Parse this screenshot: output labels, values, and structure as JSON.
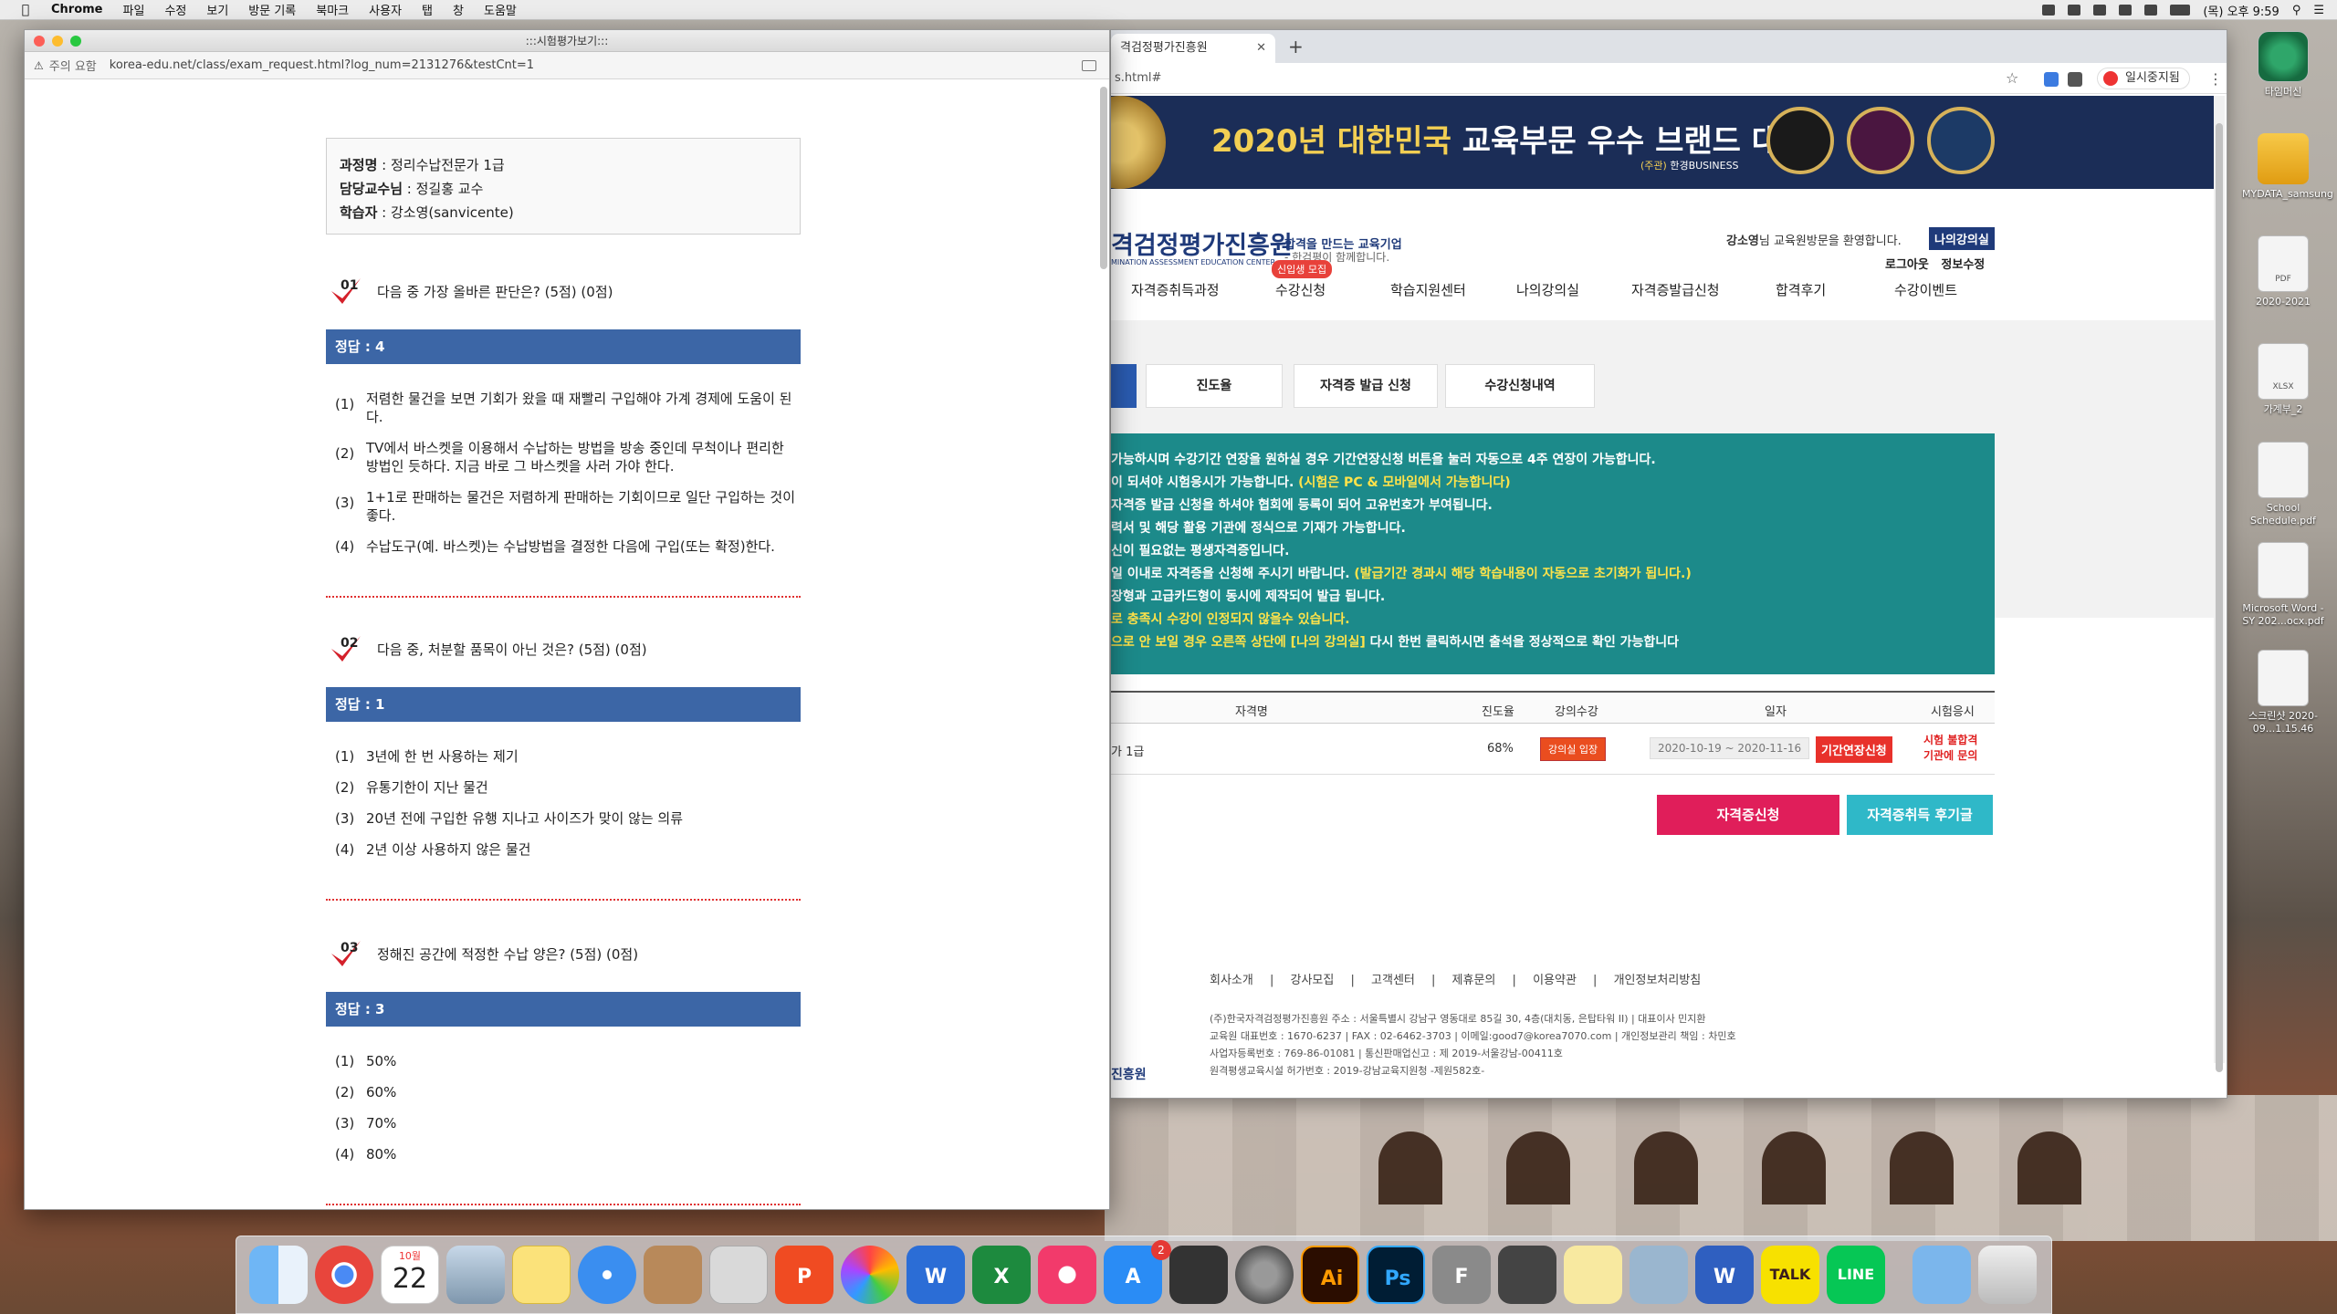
{
  "menubar": {
    "app": "Chrome",
    "items": [
      "파일",
      "수정",
      "보기",
      "방문 기록",
      "북마크",
      "사용자",
      "탭",
      "창",
      "도움말"
    ],
    "clock": "(목) 오후 9:59"
  },
  "popup": {
    "title": ":::시험평가보기:::",
    "security": "주의 요함",
    "url": "korea-edu.net/class/exam_request.html?log_num=2131276&testCnt=1",
    "info": {
      "course_label": "과정명",
      "course": "정리수납전문가 1급",
      "prof_label": "담당교수님",
      "prof": "정길홍 교수",
      "student_label": "학습자",
      "student": "강소영(sanvicente)"
    },
    "questions": [
      {
        "num": "01",
        "text": "다음 중 가장 올바른 판단은? (5점) (0점)",
        "answer": "정답 : 4",
        "options": [
          {
            "n": "(1)",
            "t": "저렴한 물건을 보면 기회가 왔을 때 재빨리 구입해야 가계 경제에 도움이 된다."
          },
          {
            "n": "(2)",
            "t": "TV에서 바스켓을 이용해서 수납하는 방법을 방송 중인데 무척이나 편리한 방법인 듯하다. 지금 바로 그 바스켓을 사러 가야 한다."
          },
          {
            "n": "(3)",
            "t": "1+1로 판매하는 물건은 저렴하게 판매하는 기회이므로 일단 구입하는 것이 좋다."
          },
          {
            "n": "(4)",
            "t": "수납도구(예. 바스켓)는 수납방법을 결정한 다음에 구입(또는 확정)한다."
          }
        ]
      },
      {
        "num": "02",
        "text": "다음 중, 처분할 품목이 아닌 것은? (5점) (0점)",
        "answer": "정답 : 1",
        "options": [
          {
            "n": "(1)",
            "t": "3년에 한 번 사용하는 제기"
          },
          {
            "n": "(2)",
            "t": "유통기한이 지난 물건"
          },
          {
            "n": "(3)",
            "t": "20년 전에 구입한 유행 지나고 사이즈가 맞이 않는 의류"
          },
          {
            "n": "(4)",
            "t": "2년 이상 사용하지 않은 물건"
          }
        ]
      },
      {
        "num": "03",
        "text": "정해진 공간에 적정한 수납 양은? (5점) (0점)",
        "answer": "정답 : 3",
        "options": [
          {
            "n": "(1)",
            "t": "50%"
          },
          {
            "n": "(2)",
            "t": "60%"
          },
          {
            "n": "(3)",
            "t": "70%"
          },
          {
            "n": "(4)",
            "t": "80%"
          }
        ]
      }
    ]
  },
  "chrome": {
    "tab_title": "격검정평가진흥원",
    "url_fragment": "s.html#",
    "pause_label": "일시중지됨",
    "banner_title_a": "2020년 ",
    "banner_title_b": "대한민국",
    "banner_title_c": " 교육부문 우수 브랜드 대상",
    "banner_sub_a": "(주관) ",
    "banner_sub_b": "한경BUSINESS",
    "logo": "격검정평가진흥원",
    "logo_en": "MINATION ASSESSMENT  EDUCATION CENTER",
    "slogan": "합격을 만드는 교육기업",
    "slogan2": "- 한검평이 함께합니다.",
    "welcome_name": "강소영",
    "welcome_rest": "님 교육원방문을 환영합니다.",
    "my_lecture": "나의강의실",
    "logout": "로그아웃",
    "edit_info": "정보수정",
    "nav": [
      "자격증취득과정",
      "수강신청",
      "학습지원센터",
      "나의강의실",
      "자격증발급신청",
      "합격후기",
      "수강이벤트"
    ],
    "new_tag": "신입생 모집",
    "subtabs": [
      "진도율",
      "자격증 발급 신청",
      "수강신청내역"
    ],
    "notice": [
      {
        "a": "가능하시며 수강기간 연장을 원하실 경우 기간연장신청 버튼을 눌러 자동으로 4주 연장이 가능합니다.",
        "b": ""
      },
      {
        "a": "이 되셔야 시험응시가 가능합니다. ",
        "b": "(시험은 PC & 모바일에서 가능합니다)"
      },
      {
        "a": "자격증 발급 신청을 하셔야 협회에 등록이 되어 고유번호가 부여됩니다.",
        "b": ""
      },
      {
        "a": "력서 및 해당 활용 기관에 정식으로 기재가 가능합니다.",
        "b": ""
      },
      {
        "a": "신이 필요없는 평생자격증입니다.",
        "b": ""
      },
      {
        "a": "일 이내로 자격증을 신청해 주시기 바랍니다. ",
        "b": "(발급기간 경과시 해당 학습내용이 자동으로 초기화가 됩니다.)"
      },
      {
        "a": "장형과 고급카드형이 동시에 제작되어 발급 됩니다.",
        "b": ""
      },
      {
        "a": "",
        "b": "로 충족시 수강이 인정되지 않을수 있습니다."
      },
      {
        "a": "",
        "b": "으로 안 보일 경우 오른쪽 상단에 [나의 강의실]",
        "c": " 다시 한번 클릭하시면 출석을 정상적으로 확인 가능합니다"
      }
    ],
    "table": {
      "headers": [
        "자격명",
        "진도율",
        "강의수강",
        "일자",
        "시험응시"
      ],
      "row": {
        "name": "가 1급",
        "progress": "68%",
        "enter": "강의실 입장",
        "dates": "2020-10-19 ~ 2020-11-16",
        "extend": "기간연장신청",
        "exam1": "시험 불합격",
        "exam2": "기관에 문의"
      }
    },
    "btn_apply": "자격증신청",
    "btn_review": "자격증취득 후기글",
    "footer_links": [
      "회사소개",
      "|",
      "강사모집",
      "|",
      "고객센터",
      "|",
      "제휴문의",
      "|",
      "이용약관",
      "|",
      "개인정보처리방침"
    ],
    "footer_addr": [
      "(주)한국자격검정평가진흥원 주소 : 서울특별시 강남구 영동대로 85길 30, 4층(대치동, 은탑타워 II) | 대표이사 민지환",
      "교육원 대표번호 : 1670-6237 | FAX : 02-6462-3703 | 이메일:good7@korea7070.com | 개인정보관리 책임 : 차민호",
      "사업자등록번호 : 769-86-01081 | 통신판매업신고 : 제 2019-서울강남-00411호",
      "원격평생교육시설 허가번호 : 2019-강남교육지원청 -제원582호-"
    ],
    "footer_logo": "진흥원"
  },
  "desktop_icons": [
    {
      "label": "타임머신",
      "kind": "tm"
    },
    {
      "label": "MYDATA_samsung",
      "kind": "drive"
    },
    {
      "label": "2020-2021",
      "kind": "doc",
      "tag": "PDF"
    },
    {
      "label": "가계부_2",
      "kind": "doc",
      "tag": "XLSX"
    },
    {
      "label": "School Schedule.pdf",
      "kind": "doc",
      "tag": ""
    },
    {
      "label": "Microsoft Word - SY 202...ocx.pdf",
      "kind": "doc",
      "tag": ""
    },
    {
      "label": "스크린샷 2020-09...1.15.46",
      "kind": "doc",
      "tag": ""
    }
  ],
  "dock": {
    "calendar_month": "10월",
    "calendar_day": "22",
    "appstore_badge": "2",
    "ai": "Ai",
    "ps": "Ps",
    "f": "F",
    "talk": "TALK",
    "line": "LINE",
    "w": "W"
  }
}
